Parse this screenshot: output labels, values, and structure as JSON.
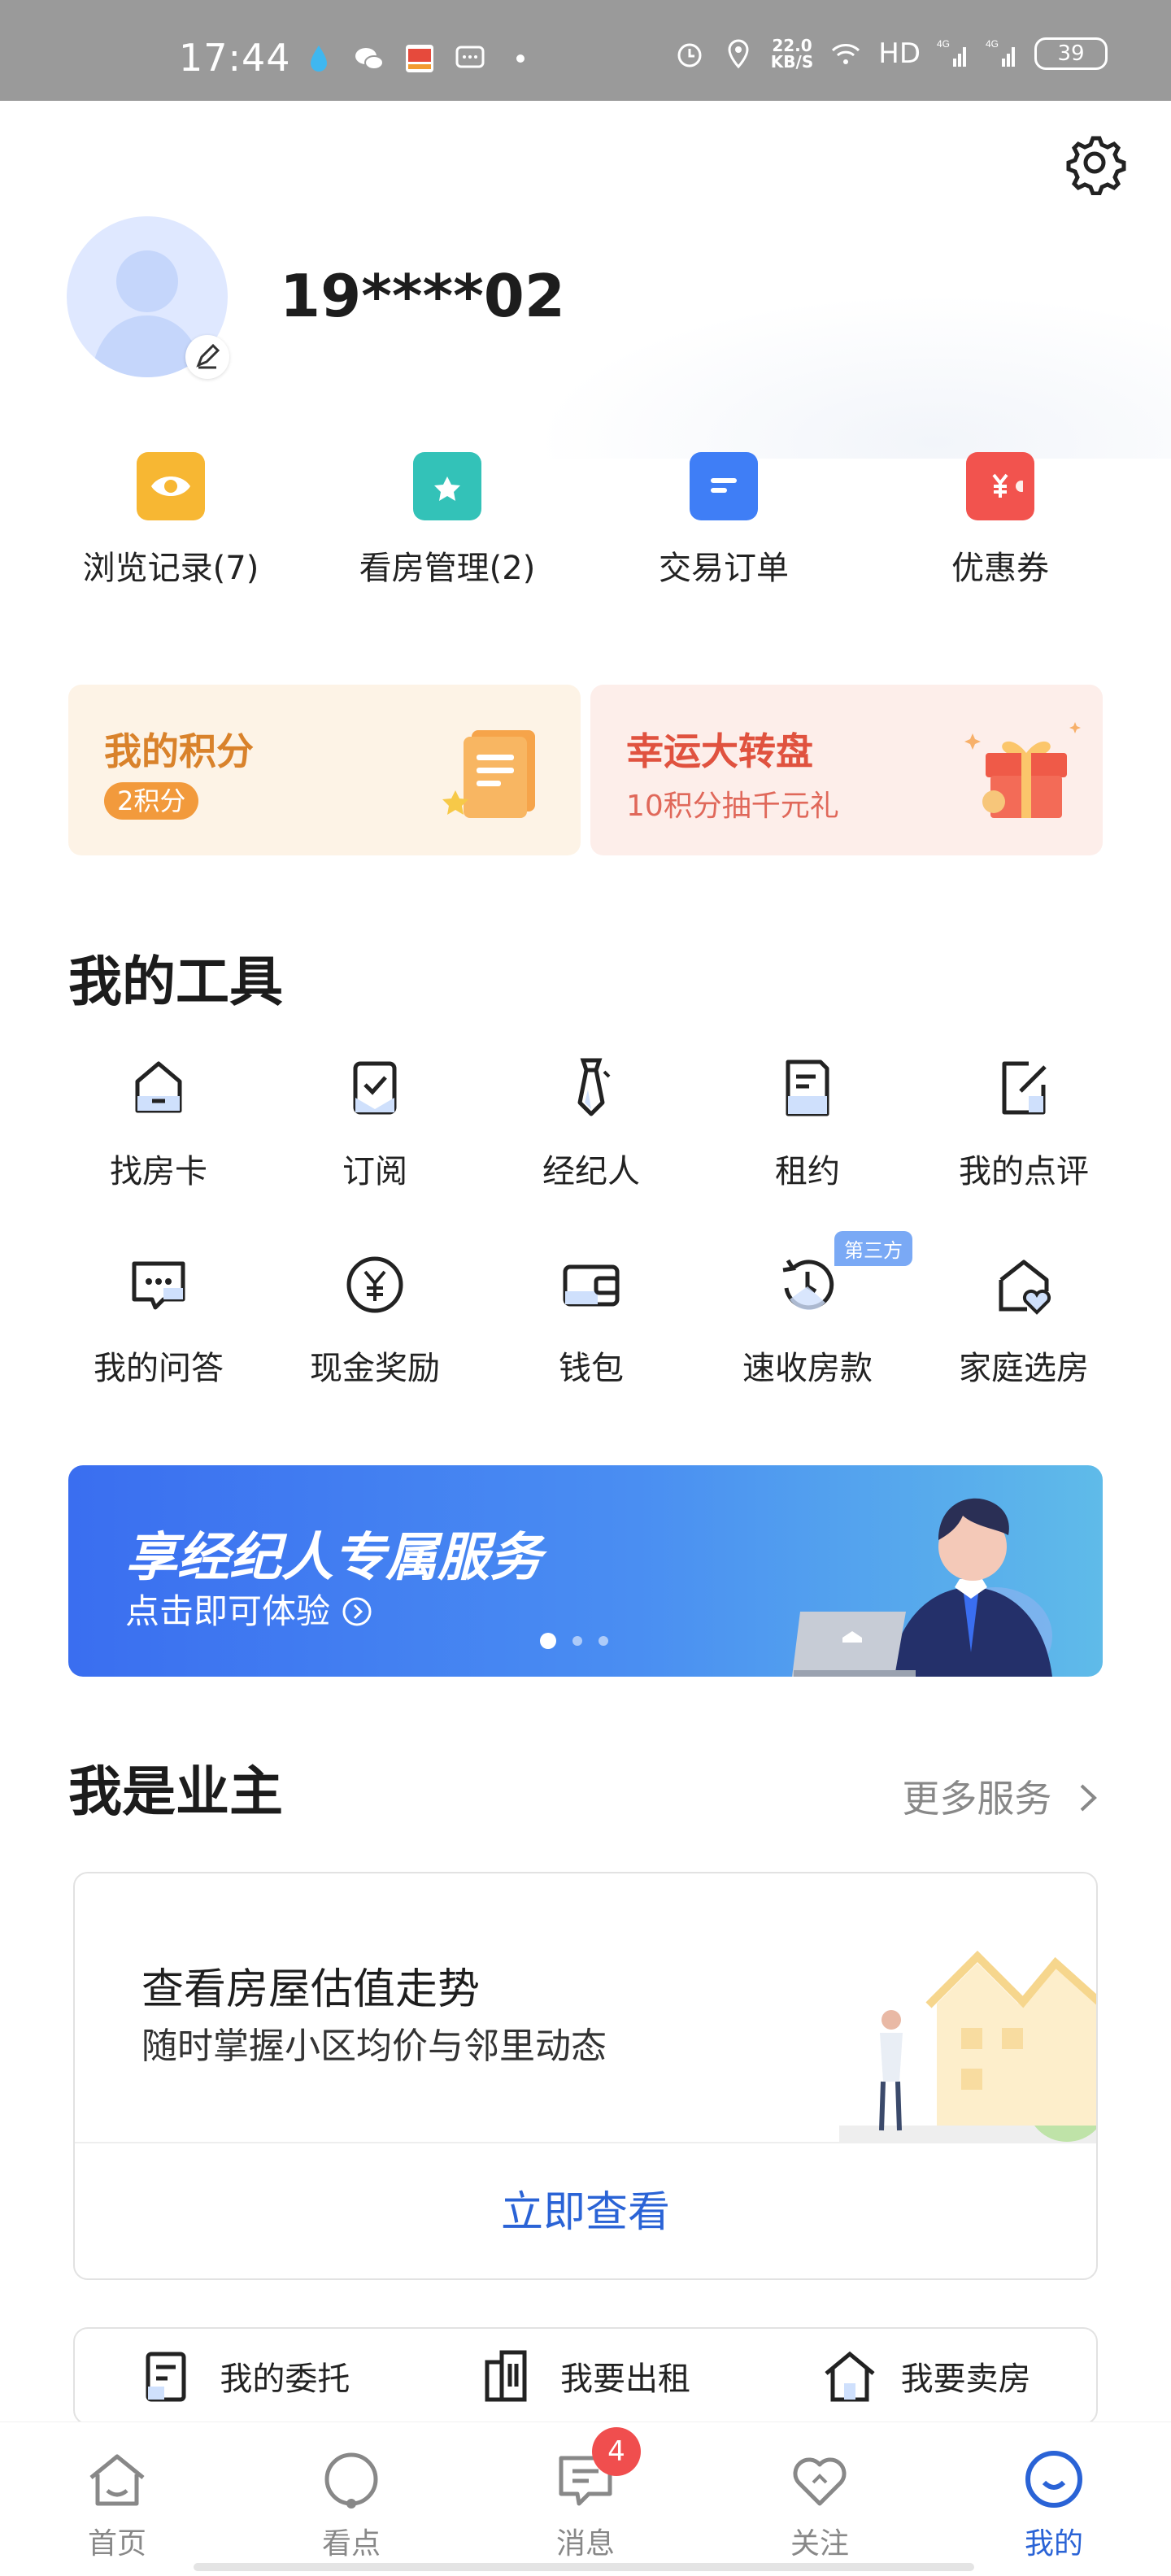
{
  "status_bar": {
    "time": "17:44",
    "net_speed_value": "22.0",
    "net_speed_unit": "KB/S",
    "hd": "HD",
    "signal_label_1": "4G",
    "signal_label_2": "4G",
    "battery": "39"
  },
  "user": {
    "phone": "19****02"
  },
  "quick_actions": [
    {
      "label": "浏览记录(7)",
      "icon": "eye-icon",
      "color": "#f7b733"
    },
    {
      "label": "看房管理(2)",
      "icon": "folder-star-icon",
      "color": "#33c2b8"
    },
    {
      "label": "交易订单",
      "icon": "document-icon",
      "color": "#3f7ef6"
    },
    {
      "label": "优惠券",
      "icon": "coupon-icon",
      "color": "#f2534e"
    }
  ],
  "points_card": {
    "title": "我的积分",
    "badge": "2积分"
  },
  "lucky_card": {
    "title": "幸运大转盘",
    "subtitle": "10积分抽千元礼"
  },
  "tools": {
    "title": "我的工具",
    "items": [
      {
        "label": "找房卡",
        "icon": "house-card-icon"
      },
      {
        "label": "订阅",
        "icon": "subscribe-check-icon"
      },
      {
        "label": "经纪人",
        "icon": "tie-icon"
      },
      {
        "label": "租约",
        "icon": "lease-doc-icon"
      },
      {
        "label": "我的点评",
        "icon": "edit-review-icon"
      },
      {
        "label": "我的问答",
        "icon": "chat-dots-icon"
      },
      {
        "label": "现金奖励",
        "icon": "yen-coin-icon"
      },
      {
        "label": "钱包",
        "icon": "wallet-icon"
      },
      {
        "label": "速收房款",
        "icon": "clock-refresh-icon",
        "tag": "第三方"
      },
      {
        "label": "家庭选房",
        "icon": "home-heart-icon"
      }
    ]
  },
  "banner": {
    "title": "享经纪人专属服务",
    "subtitle": "点击即可体验",
    "slide_count": 3,
    "active_slide": 1
  },
  "owner": {
    "title": "我是业主",
    "more": "更多服务",
    "card_title": "查看房屋估值走势",
    "card_subtitle": "随时掌握小区均价与邻里动态",
    "card_button": "立即查看"
  },
  "entrust_row": [
    {
      "label": "我的委托",
      "icon": "entrust-doc-icon"
    },
    {
      "label": "我要出租",
      "icon": "building-rent-icon"
    },
    {
      "label": "我要卖房",
      "icon": "house-sell-icon"
    }
  ],
  "nav": {
    "items": [
      {
        "label": "首页",
        "icon": "home-icon"
      },
      {
        "label": "看点",
        "icon": "discover-icon"
      },
      {
        "label": "消息",
        "icon": "message-icon",
        "badge": "4"
      },
      {
        "label": "关注",
        "icon": "heart-icon"
      },
      {
        "label": "我的",
        "icon": "profile-icon",
        "active": true
      }
    ]
  },
  "colors": {
    "accent": "#2a63d6",
    "badge_red": "#f04e4e",
    "points_orange": "#d9822b",
    "lucky_red": "#e0523f"
  }
}
